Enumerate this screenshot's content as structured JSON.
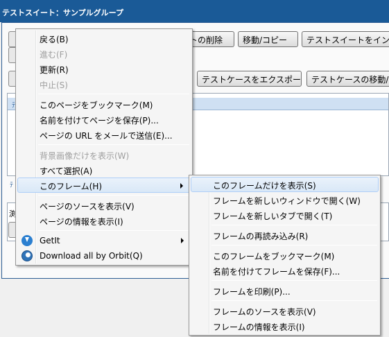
{
  "window": {
    "title": "テストスイート：サンプルグループ"
  },
  "background": {
    "toolbar_row1": [
      "トの削除",
      "移動/コピー",
      "テストスイートをインポー"
    ],
    "toolbar_row2": [
      "テストケースをエクスポート",
      "テストケースの移動/コ"
    ],
    "left_labels": [
      "ﾃ",
      "ﾃ",
      "ﾃ",
      "渕"
    ]
  },
  "context_menu": {
    "items": [
      {
        "label": "戻る(B)",
        "state": "enabled"
      },
      {
        "label": "進む(F)",
        "state": "disabled"
      },
      {
        "label": "更新(R)",
        "state": "enabled"
      },
      {
        "label": "中止(S)",
        "state": "disabled"
      },
      {
        "label": "このページをブックマーク(M)",
        "state": "enabled"
      },
      {
        "label": "名前を付けてページを保存(P)...",
        "state": "enabled"
      },
      {
        "label": "ページの URL をメールで送信(E)...",
        "state": "enabled"
      },
      {
        "label": "背景画像だけを表示(W)",
        "state": "disabled"
      },
      {
        "label": "すべて選択(A)",
        "state": "enabled"
      },
      {
        "label": "このフレーム(H)",
        "state": "highlighted"
      },
      {
        "label": "ページのソースを表示(V)",
        "state": "enabled"
      },
      {
        "label": "ページの情報を表示(I)",
        "state": "enabled"
      },
      {
        "label": "GetIt",
        "state": "enabled",
        "icon": "getit-icon"
      },
      {
        "label": "Download all by Orbit(Q)",
        "state": "enabled",
        "icon": "orbit-icon"
      }
    ]
  },
  "submenu": {
    "items": [
      {
        "label": "このフレームだけを表示(S)",
        "state": "highlighted"
      },
      {
        "label": "フレームを新しいウィンドウで開く(W)",
        "state": "enabled"
      },
      {
        "label": "フレームを新しいタブで開く(T)",
        "state": "enabled"
      },
      {
        "label": "フレームの再読み込み(R)",
        "state": "enabled"
      },
      {
        "label": "このフレームをブックマーク(M)",
        "state": "enabled"
      },
      {
        "label": "名前を付けてフレームを保存(F)...",
        "state": "enabled"
      },
      {
        "label": "フレームを印刷(P)...",
        "state": "enabled"
      },
      {
        "label": "フレームのソースを表示(V)",
        "state": "enabled"
      },
      {
        "label": "フレームの情報を表示(I)",
        "state": "enabled"
      }
    ]
  }
}
